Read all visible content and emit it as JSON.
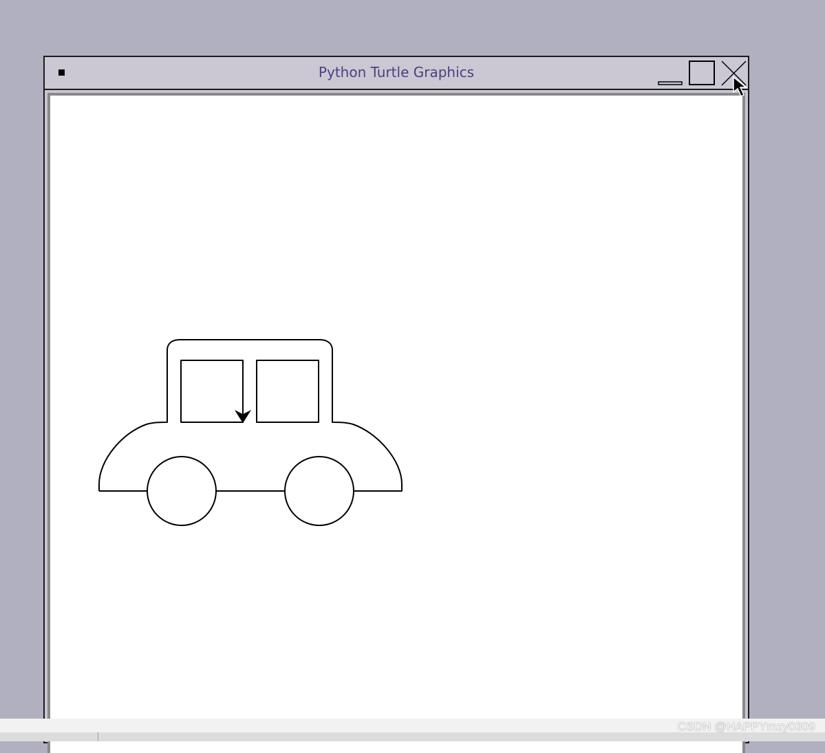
{
  "window": {
    "title": "Python Turtle Graphics",
    "controls": {
      "minimize": "minimize-icon",
      "maximize": "maximize-icon",
      "close": "close-icon"
    }
  },
  "canvas": {
    "background": "#ffffff",
    "drawing": "car",
    "pen_color": "#000000",
    "turtle_shape": "arrow",
    "turtle_heading": "down"
  },
  "watermark": {
    "text": "CSDN @HAPPYmzy0309"
  },
  "colors": {
    "desktop": "#b1b0c0",
    "titlebar": "#cbc8d4",
    "title_text": "#4a3f80"
  }
}
